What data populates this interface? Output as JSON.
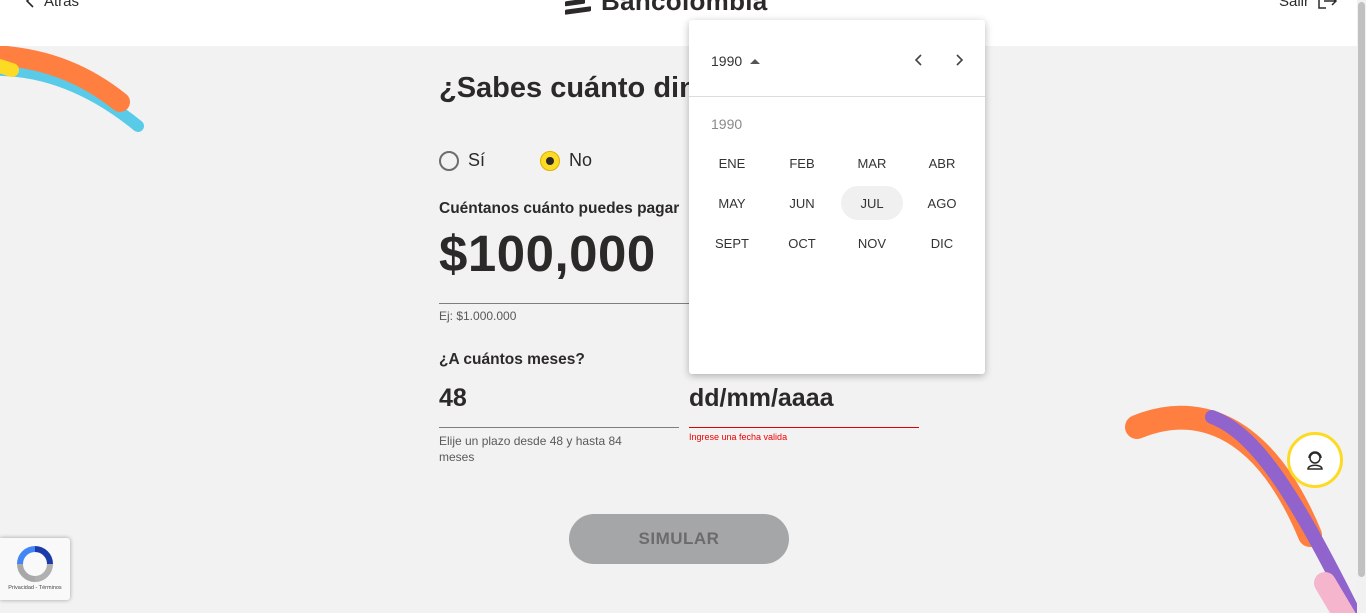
{
  "header": {
    "back_label": "Atrás",
    "brand": "Bancolombia",
    "exit_label": "Salir"
  },
  "question": {
    "title": "¿Sabes cuánto dine",
    "options": [
      "Sí",
      "No"
    ],
    "selected": "No"
  },
  "amount": {
    "label": "Cuéntanos cuánto puedes pagar",
    "value": "$100,000",
    "hint": "Ej: $1.000.000"
  },
  "months": {
    "label": "¿A cuántos meses?",
    "value": "48",
    "hint": "Elije un plazo desde 48 y hasta 84 meses"
  },
  "date": {
    "placeholder": "dd/mm/aaaa",
    "error": "Ingrese una fecha valida"
  },
  "submit_label": "SIMULAR",
  "recaptcha_text": "Privacidad - Términos",
  "picker": {
    "year_selector": "1990",
    "year_label": "1990",
    "months": [
      "ENE",
      "FEB",
      "MAR",
      "ABR",
      "MAY",
      "JUN",
      "JUL",
      "AGO",
      "SEPT",
      "OCT",
      "NOV",
      "DIC"
    ],
    "selected_month": "JUL"
  },
  "colors": {
    "accent_yellow": "#FDDA24",
    "orange": "#FF7F41",
    "cyan": "#59CBE8",
    "purple": "#9063CD",
    "pink": "#F5B6CD",
    "error": "#E00000"
  }
}
